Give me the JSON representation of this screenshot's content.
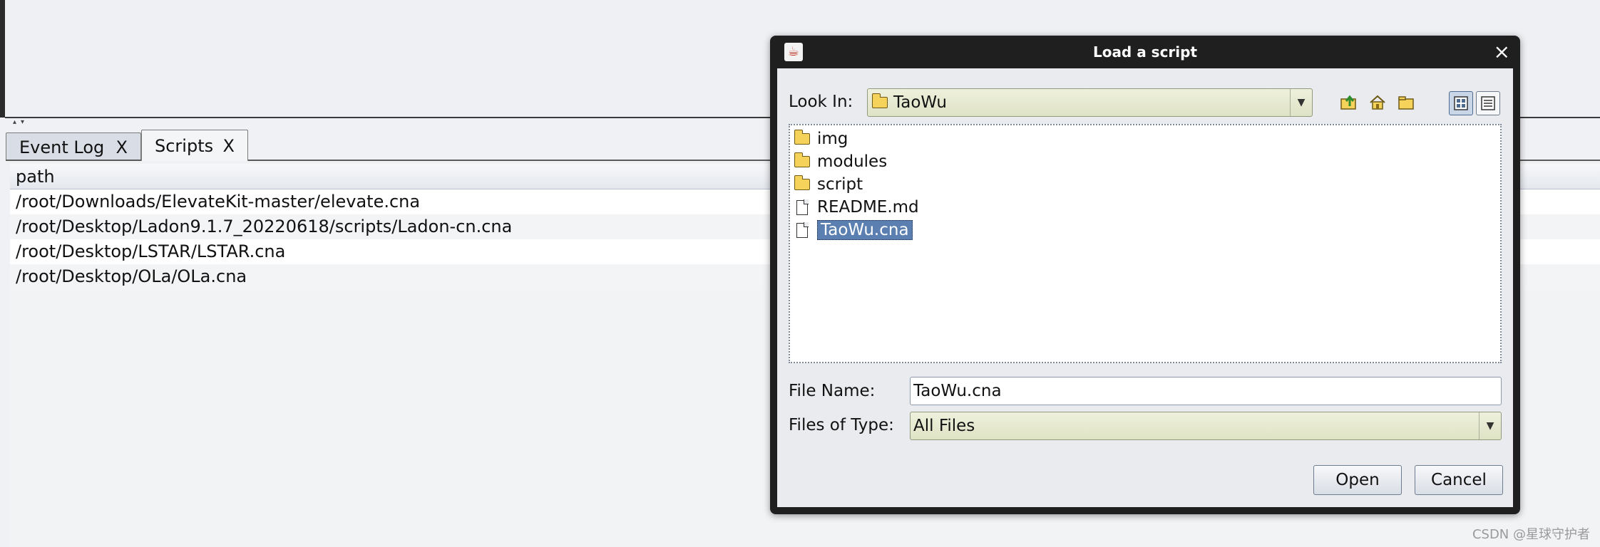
{
  "tabs": [
    {
      "label": "Event Log",
      "close": "X",
      "active": false
    },
    {
      "label": "Scripts",
      "close": "X",
      "active": true
    }
  ],
  "scripts_table": {
    "column_header": "path",
    "rows": [
      "/root/Downloads/ElevateKit-master/elevate.cna",
      "/root/Desktop/Ladon9.1.7_20220618/scripts/Ladon-cn.cna",
      "/root/Desktop/LSTAR/LSTAR.cna",
      "/root/Desktop/OLa/OLa.cna"
    ]
  },
  "dialog": {
    "title": "Load a script",
    "close_glyph": "×",
    "look_in_label": "Look In:",
    "look_in_value": "TaoWu",
    "files": [
      {
        "name": "img",
        "kind": "folder"
      },
      {
        "name": "modules",
        "kind": "folder"
      },
      {
        "name": "script",
        "kind": "folder"
      },
      {
        "name": "README.md",
        "kind": "file"
      },
      {
        "name": "TaoWu.cna",
        "kind": "file",
        "selected": true
      }
    ],
    "file_name_label": "File Name:",
    "file_name_value": "TaoWu.cna",
    "files_of_type_label": "Files of Type:",
    "files_of_type_value": "All Files",
    "open_button": "Open",
    "cancel_button": "Cancel"
  },
  "watermark": "CSDN @星球守护者",
  "colors": {
    "dialog_frame": "#1f1f1f",
    "selection": "#5a7fb0",
    "combo_bg": "#e4e7cc"
  }
}
